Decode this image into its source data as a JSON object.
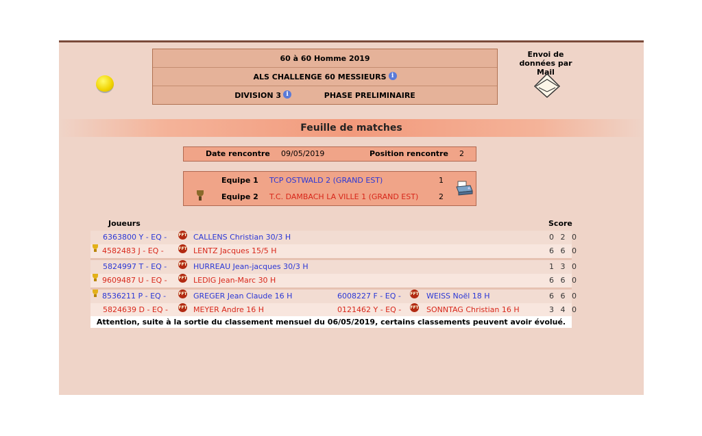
{
  "header": {
    "line1": "60  à 60  Homme  2019",
    "line2": "ALS CHALLENGE 60 MESSIEURS",
    "division": "DIVISION 3",
    "phase": "PHASE PRELIMINAIRE"
  },
  "mail": {
    "label": "Envoi de données par Mail"
  },
  "section_title": "Feuille de matches",
  "meeting": {
    "date_label": "Date rencontre",
    "date_value": "09/05/2019",
    "position_label": "Position rencontre",
    "position_value": "2"
  },
  "teams": {
    "team1_label": "Equipe 1",
    "team1_name": "TCP OSTWALD 2 (GRAND EST)",
    "team1_score": "1",
    "team2_label": "Equipe 2",
    "team2_name": "T.C. DAMBACH LA VILLE 1 (GRAND EST)",
    "team2_score": "2"
  },
  "table": {
    "col_players": "Joueurs",
    "col_score": "Score",
    "matches": [
      {
        "p1_id": "6363800 Y -  EQ -",
        "p1_name": "CALLENS  Christian  30/3 H",
        "p2_id": "4582483 J -  EQ -",
        "p2_name": "LENTZ  Jacques 15/5 H",
        "score1": "0 2 0",
        "score2": "6 6 0"
      },
      {
        "p1_id": "5824997 T -  EQ -",
        "p1_name": "HURREAU  Jean-jacques  30/3 H",
        "p2_id": "9609487 U -  EQ -",
        "p2_name": "LEDIG  Jean-Marc 30 H",
        "score1": "1 3 0",
        "score2": "6 6 0"
      }
    ],
    "doubles": {
      "a1_id": "8536211 P -  EQ -",
      "a1_name": "GREGER  Jean Claude  16 H",
      "a2_id": "6008227 F -  EQ -",
      "a2_name": "WEISS  Noël  18 H",
      "b1_id": "5824639 D -  EQ -",
      "b1_name": "MEYER  Andre 16 H",
      "b2_id": "0121462 Y -  EQ -",
      "b2_name": "SONNTAG  Christian 16 H",
      "score1": "6 6 0",
      "score2": "3 4 0"
    },
    "ff_badge": "FFT"
  },
  "notice": "Attention, suite à la sortie du classement mensuel du 06/05/2019, certains classements peuvent avoir évolué."
}
